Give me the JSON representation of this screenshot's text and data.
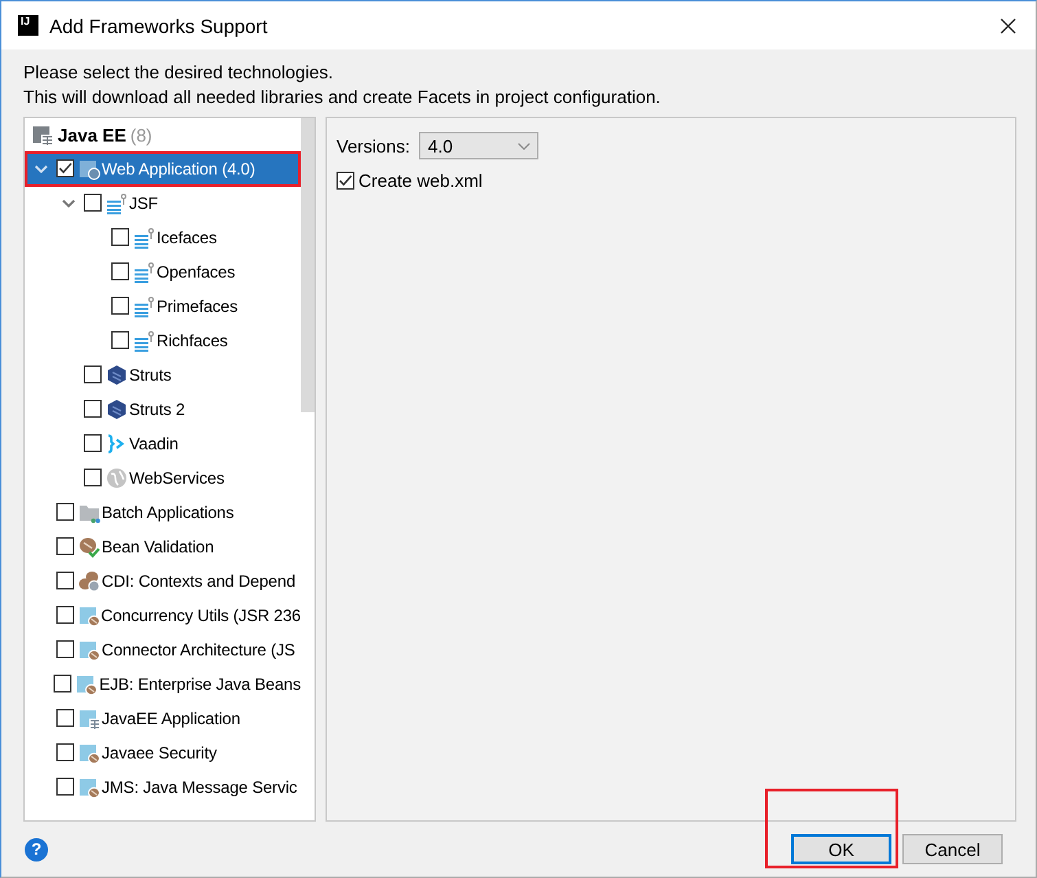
{
  "window": {
    "logo": "IJ",
    "title": "Add Frameworks Support"
  },
  "intro": [
    "Please select the desired technologies.",
    "This will download all needed libraries and create Facets in project configuration."
  ],
  "tree": {
    "group": {
      "label": "Java EE",
      "count": "(8)"
    },
    "items": [
      {
        "label": "Web Application (4.0)",
        "kind": "web",
        "checked": true,
        "selected": true,
        "highlighted": true,
        "expanded": true,
        "children": [
          {
            "label": "JSF",
            "kind": "jsf",
            "checked": false,
            "selected": false,
            "highlighted": false,
            "expanded": true,
            "children": [
              {
                "label": "Icefaces",
                "kind": "jsf",
                "checked": false,
                "selected": false,
                "highlighted": false
              },
              {
                "label": "Openfaces",
                "kind": "jsf",
                "checked": false,
                "selected": false,
                "highlighted": false
              },
              {
                "label": "Primefaces",
                "kind": "jsf",
                "checked": false,
                "selected": false,
                "highlighted": false
              },
              {
                "label": "Richfaces",
                "kind": "jsf",
                "checked": false,
                "selected": false,
                "highlighted": false
              }
            ]
          },
          {
            "label": "Struts",
            "kind": "struts",
            "checked": false,
            "selected": false,
            "highlighted": false
          },
          {
            "label": "Struts 2",
            "kind": "struts",
            "checked": false,
            "selected": false,
            "highlighted": false
          },
          {
            "label": "Vaadin",
            "kind": "vaadin",
            "checked": false,
            "selected": false,
            "highlighted": false
          },
          {
            "label": "WebServices",
            "kind": "webservice",
            "checked": false,
            "selected": false,
            "highlighted": false
          }
        ]
      },
      {
        "label": "Batch Applications",
        "kind": "batch",
        "checked": false,
        "selected": false,
        "highlighted": false
      },
      {
        "label": "Bean Validation",
        "kind": "bean",
        "checked": false,
        "selected": false,
        "highlighted": false
      },
      {
        "label": "CDI: Contexts and Depend",
        "kind": "cdi",
        "checked": false,
        "selected": false,
        "highlighted": false
      },
      {
        "label": "Concurrency Utils (JSR 236",
        "kind": "lib",
        "checked": false,
        "selected": false,
        "highlighted": false
      },
      {
        "label": "Connector Architecture (JS",
        "kind": "lib",
        "checked": false,
        "selected": false,
        "highlighted": false
      },
      {
        "label": "EJB: Enterprise Java Beans",
        "kind": "lib",
        "checked": false,
        "selected": false,
        "highlighted": false
      },
      {
        "label": "JavaEE Application",
        "kind": "app",
        "checked": false,
        "selected": false,
        "highlighted": false
      },
      {
        "label": "Javaee Security",
        "kind": "lib",
        "checked": false,
        "selected": false,
        "highlighted": false
      },
      {
        "label": "JMS: Java Message Servic",
        "kind": "lib",
        "checked": false,
        "selected": false,
        "highlighted": false
      }
    ]
  },
  "settings": {
    "versions": {
      "label": "Versions:",
      "value": "4.0"
    },
    "create_xml": {
      "label": "Create web.xml",
      "checked": true
    }
  },
  "help": {
    "label": "?"
  },
  "buttons": [
    {
      "label": "OK",
      "default": true,
      "highlighted": true
    },
    {
      "label": "Cancel",
      "default": false,
      "highlighted": false
    }
  ]
}
